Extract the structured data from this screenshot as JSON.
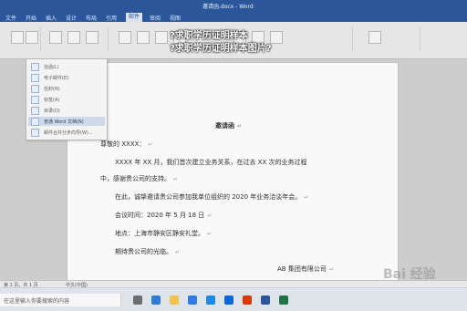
{
  "app": {
    "window_title": "邀请函.docx - Word"
  },
  "ribbon_tabs": [
    {
      "label": "文件"
    },
    {
      "label": "开始"
    },
    {
      "label": "插入"
    },
    {
      "label": "设计"
    },
    {
      "label": "布局"
    },
    {
      "label": "引用"
    },
    {
      "label": "邮件"
    },
    {
      "label": "审阅"
    },
    {
      "label": "视图"
    }
  ],
  "overlay": {
    "line1": "?求职学历证明样本",
    "line2": "?求职学历证明样本图片?"
  },
  "menu": {
    "items": [
      {
        "label": "信函(L)"
      },
      {
        "label": "电子邮件(E)"
      },
      {
        "label": "信封(N)"
      },
      {
        "label": "标签(A)"
      },
      {
        "label": "目录(D)"
      },
      {
        "label": "普通 Word 文档(N)",
        "active": true
      },
      {
        "label": "邮件合并分步向导(W)..."
      }
    ]
  },
  "letter": {
    "title": "邀请函",
    "greeting": "尊敬的 XXXX：",
    "p1": "XXXX 年 XX 月，我们首次建立业务关系，在过去 XX 次的业务过程",
    "p1b": "中，感谢贵公司的支持。",
    "p2": "在此，诚挚邀请贵公司参加我单位组织的 2020 年业务洽谈年会。",
    "meeting_time": "会议时间：2020 年 5 月 18 日",
    "location": "地点：上海市静安区静安礼堂。",
    "closing": "期待贵公司的光临。",
    "signature": "AB 集团有限公司",
    "para_mark": "↵"
  },
  "statusbar": {
    "page": "第 1 页，共 1 页",
    "lang": "中文(中国)"
  },
  "taskbar": {
    "search_placeholder": "在这里输入你要搜索的内容"
  },
  "watermark": {
    "text": "Bai 经验"
  },
  "colors": {
    "word_blue": "#2b579a",
    "menu_highlight": "#cfd9e8"
  }
}
